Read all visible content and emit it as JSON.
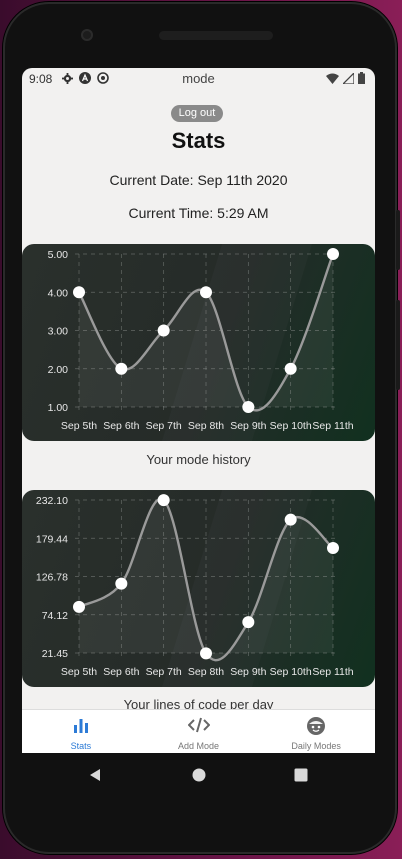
{
  "status_bar": {
    "time": "9:08",
    "app_title": "mode",
    "left_icons": [
      "gear-icon",
      "a-circle-icon",
      "sync-circle-icon"
    ],
    "right_icons": [
      "wifi-icon",
      "signal-icon",
      "battery-icon"
    ]
  },
  "header": {
    "logout_label": "Log out",
    "title": "Stats",
    "current_date": "Current Date: Sep 11th 2020",
    "current_time": "Current Time: 5:29 AM"
  },
  "charts": [
    {
      "caption": "Your mode history",
      "chart_data": {
        "type": "line",
        "categories": [
          "Sep 5th",
          "Sep 6th",
          "Sep 7th",
          "Sep 8th",
          "Sep 9th",
          "Sep 10th",
          "Sep 11th"
        ],
        "values": [
          4,
          2,
          3,
          4,
          1,
          2,
          5
        ],
        "y_ticks": [
          "5.00",
          "4.00",
          "3.00",
          "2.00",
          "1.00"
        ],
        "ylim": [
          1,
          5
        ],
        "grid": true
      }
    },
    {
      "caption": "Your lines of code per day",
      "chart_data": {
        "type": "line",
        "categories": [
          "Sep 5th",
          "Sep 6th",
          "Sep 7th",
          "Sep 8th",
          "Sep 9th",
          "Sep 10th",
          "Sep 11th"
        ],
        "values": [
          85,
          117,
          232,
          21,
          64,
          205,
          166
        ],
        "y_ticks": [
          "232.10",
          "179.44",
          "126.78",
          "74.12",
          "21.45"
        ],
        "ylim": [
          21.45,
          232.1
        ],
        "grid": true
      }
    }
  ],
  "nav": {
    "items": [
      {
        "label": "Stats",
        "icon": "bar-chart-icon",
        "active": true
      },
      {
        "label": "Add Mode",
        "icon": "code-icon",
        "active": false
      },
      {
        "label": "Daily Modes",
        "icon": "face-icon",
        "active": false
      }
    ],
    "active_color": "#2d7bd6"
  },
  "system_nav": [
    "back-icon",
    "home-icon",
    "recents-icon"
  ]
}
